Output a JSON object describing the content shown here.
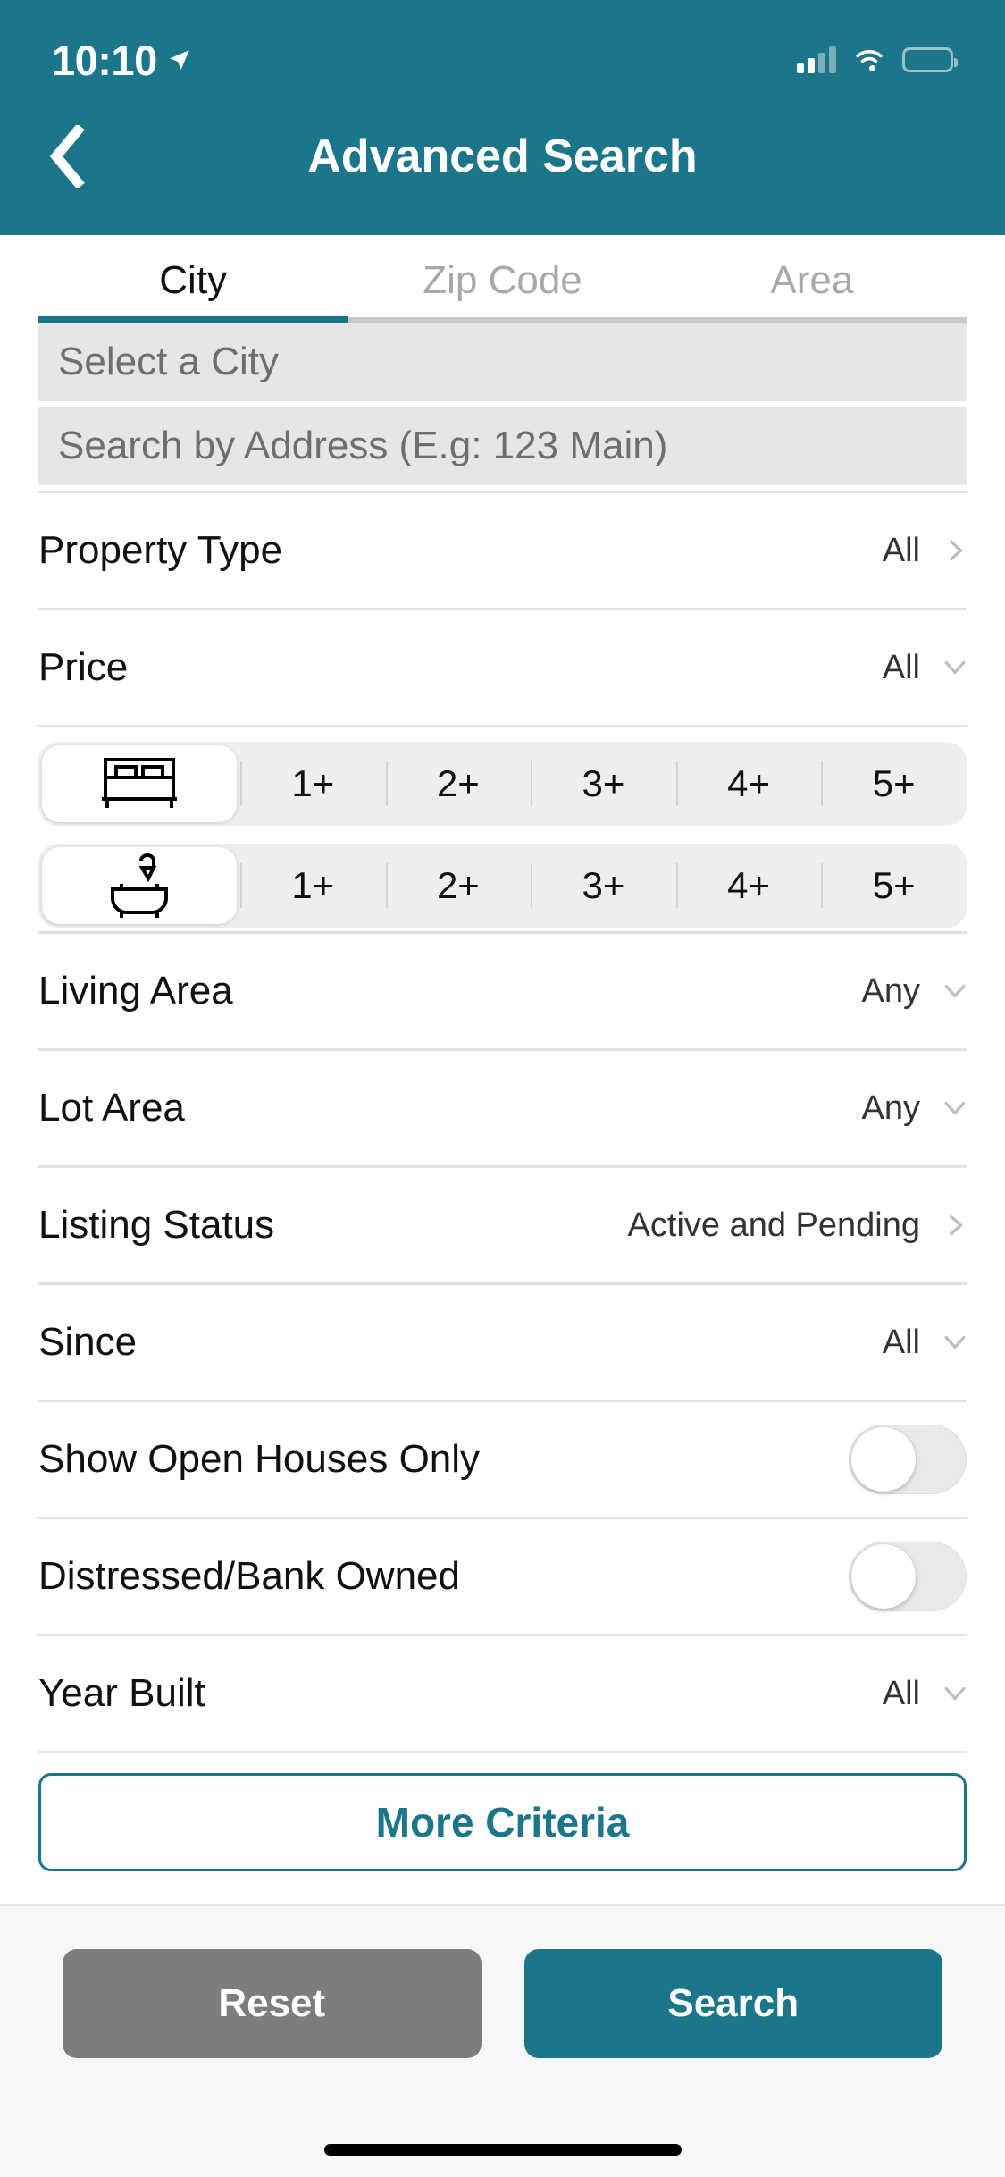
{
  "theme": {
    "accent": "#1B7689",
    "reset_gray": "#7d7d7d",
    "field_bg": "#e6e6e6"
  },
  "status_bar": {
    "time": "10:10",
    "location_icon": "location-arrow-icon",
    "signal_icon": "cellular-signal-icon",
    "wifi_icon": "wifi-icon",
    "battery_icon": "battery-full-icon"
  },
  "header": {
    "back_icon": "chevron-left-icon",
    "title": "Advanced Search"
  },
  "tabs": [
    {
      "label": "City",
      "active": true
    },
    {
      "label": "Zip Code",
      "active": false
    },
    {
      "label": "Area",
      "active": false
    }
  ],
  "fields": [
    {
      "placeholder": "Select a City",
      "value": ""
    },
    {
      "placeholder": "Search by Address (E.g: 123 Main)",
      "value": ""
    }
  ],
  "rows": {
    "property_type": {
      "label": "Property Type",
      "value": "All",
      "chevron": "chevron-right-icon"
    },
    "price": {
      "label": "Price",
      "value": "All",
      "chevron": "chevron-down-icon"
    },
    "living_area": {
      "label": "Living Area",
      "value": "Any",
      "chevron": "chevron-down-icon"
    },
    "lot_area": {
      "label": "Lot Area",
      "value": "Any",
      "chevron": "chevron-down-icon"
    },
    "listing_status": {
      "label": "Listing Status",
      "value": "Active and Pending",
      "chevron": "chevron-right-icon"
    },
    "since": {
      "label": "Since",
      "value": "All",
      "chevron": "chevron-down-icon"
    },
    "open_houses": {
      "label": "Show Open Houses Only",
      "toggle_on": false
    },
    "distressed": {
      "label": "Distressed/Bank Owned",
      "toggle_on": false
    },
    "year_built": {
      "label": "Year Built",
      "value": "All",
      "chevron": "chevron-down-icon"
    }
  },
  "beds": {
    "icon": "bed-icon",
    "options": [
      "1+",
      "2+",
      "3+",
      "4+",
      "5+"
    ],
    "selected": null
  },
  "baths": {
    "icon": "bathtub-icon",
    "options": [
      "1+",
      "2+",
      "3+",
      "4+",
      "5+"
    ],
    "selected": null
  },
  "more_criteria": {
    "label": "More Criteria"
  },
  "actions": {
    "reset_label": "Reset",
    "search_label": "Search"
  }
}
